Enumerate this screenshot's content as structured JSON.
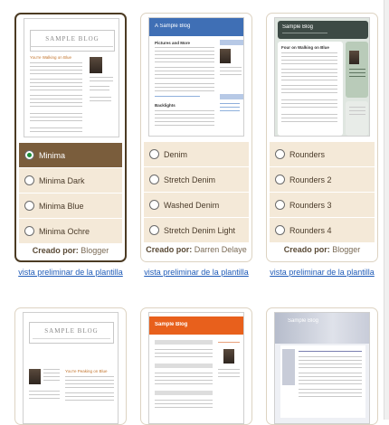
{
  "templates": [
    {
      "thumb_title": "SAMPLE BLOG",
      "thumb_post": "You're Walking on Blue",
      "options": [
        {
          "label": "Minima",
          "selected": true
        },
        {
          "label": "Minima Dark",
          "selected": false
        },
        {
          "label": "Minima Blue",
          "selected": false
        },
        {
          "label": "Minima Ochre",
          "selected": false
        }
      ],
      "creator_label": "Creado por:",
      "creator": "Blogger",
      "preview_link": "vista preliminar de la plantilla"
    },
    {
      "thumb_title": "A Sample Blog",
      "thumb_post": "Pictures and More",
      "thumb_subhead": "Backlights",
      "options": [
        {
          "label": "Denim",
          "selected": false
        },
        {
          "label": "Stretch Denim",
          "selected": false
        },
        {
          "label": "Washed Denim",
          "selected": false
        },
        {
          "label": "Stretch Denim Light",
          "selected": false
        }
      ],
      "creator_label": "Creado por:",
      "creator": "Darren Delaye",
      "preview_link": "vista preliminar de la plantilla"
    },
    {
      "thumb_title": "Sample Blog",
      "thumb_post": "Four on Walking on Blue",
      "options": [
        {
          "label": "Rounders",
          "selected": false
        },
        {
          "label": "Rounders 2",
          "selected": false
        },
        {
          "label": "Rounders 3",
          "selected": false
        },
        {
          "label": "Rounders 4",
          "selected": false
        }
      ],
      "creator_label": "Creado por:",
      "creator": "Blogger",
      "preview_link": "vista preliminar de la plantilla"
    }
  ],
  "bottom_templates": [
    {
      "thumb_title": "SAMPLE BLOG",
      "thumb_post": "You're Peaking on Blue"
    },
    {
      "thumb_title": "Sample Blog",
      "thumb_post": ""
    },
    {
      "thumb_title": "Sample Blog",
      "thumb_post": ""
    }
  ],
  "colors": {
    "selected_border": "#4c3b23",
    "option_bg": "#f4e9d8",
    "option_selected_bg": "#7a5d3c",
    "link": "#1f5bb8",
    "denim_header": "#3f6fb5",
    "rounders_header": "#3d4a45",
    "orange_header": "#e8601c"
  }
}
